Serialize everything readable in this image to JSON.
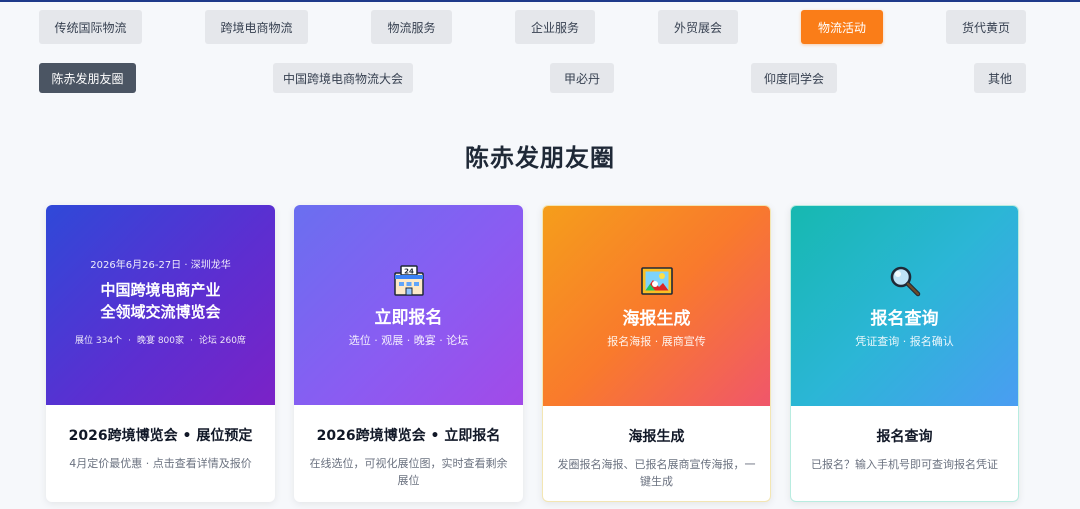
{
  "nav_primary": [
    "传统国际物流",
    "跨境电商物流",
    "物流服务",
    "企业服务",
    "外贸展会",
    "物流活动",
    "货代黄页"
  ],
  "nav_secondary": [
    "陈赤发朋友圈",
    "中国跨境电商物流大会",
    "甲必丹",
    "仰度同学会",
    "其他"
  ],
  "section_title": "陈赤发朋友圈",
  "cards": [
    {
      "event_date": "2026年6月26-27日 · 深圳龙华",
      "event_title_line1": "中国跨境电商产业",
      "event_title_line2": "全领域交流博览会",
      "stat1": "展位 334个",
      "stat2": "晚宴 800家",
      "stat3": "论坛 260席",
      "sep": "·",
      "title": "2026跨境博览会 • 展位预定",
      "desc": "4月定价最优惠 · 点击查看详情及报价"
    },
    {
      "icon": "building-icon",
      "banner_title": "立即报名",
      "banner_sub": "选位 · 观展 · 晚宴 · 论坛",
      "title": "2026跨境博览会 • 立即报名",
      "desc": "在线选位，可视化展位图，实时查看剩余展位"
    },
    {
      "icon": "picture-icon",
      "banner_title": "海报生成",
      "banner_sub": "报名海报 · 展商宣传",
      "title": "海报生成",
      "desc": "发圈报名海报、已报名展商宣传海报，一键生成"
    },
    {
      "icon": "magnifier-icon",
      "banner_title": "报名查询",
      "banner_sub": "凭证查询 · 报名确认",
      "title": "报名查询",
      "desc": "已报名？输入手机号即可查询报名凭证"
    }
  ],
  "colors": {
    "active_tab": "#fa7d18",
    "selected_tab": "#4b5563",
    "tab_bg": "#e5e7eb"
  }
}
